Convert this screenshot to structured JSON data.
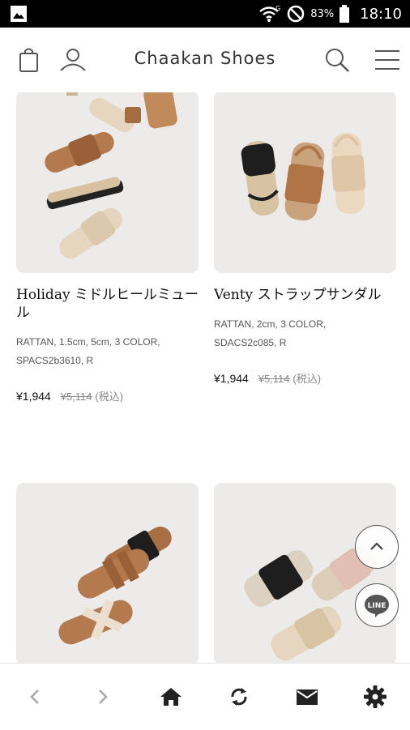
{
  "status_bar": {
    "battery_percent": "83%",
    "time": "18:10",
    "signal_label": "G"
  },
  "header": {
    "title": "Chaakan Shoes"
  },
  "products": [
    {
      "name": "Holiday ミドルヒールミュール",
      "spec_line1": "RATTAN, 1.5cm, 5cm, 3 COLOR,",
      "spec_line2": "SPACS2b3610, R",
      "price": "¥1,944",
      "old_price": "¥5,114",
      "tax_note": "(税込)"
    },
    {
      "name": "Venty ストラップサンダル",
      "spec_line1": "RATTAN, 2cm, 3 COLOR,",
      "spec_line2": "SDACS2c085, R",
      "price": "¥1,944",
      "old_price": "¥5,114",
      "tax_note": "(税込)"
    }
  ],
  "float_buttons": {
    "line_label": "LINE"
  },
  "icons": {
    "status_left": "gallery-icon",
    "wifi": "wifi-icon",
    "dnd": "do-not-disturb-icon",
    "battery": "battery-icon",
    "cart": "shopping-bag-icon",
    "account": "person-icon",
    "search": "search-icon",
    "menu": "hamburger-menu-icon",
    "back": "chevron-left-icon",
    "forward": "chevron-right-icon",
    "home": "home-icon",
    "reload": "sync-icon",
    "mail": "mail-icon",
    "settings": "gear-icon",
    "to_top": "chevron-up-icon"
  },
  "colors": {
    "status_bar_bg": "#000000",
    "card_bg": "#ebeae8",
    "tan_leather": "#b47a4e",
    "rattan_natural": "#e6d6bf",
    "black_leather": "#222222"
  }
}
